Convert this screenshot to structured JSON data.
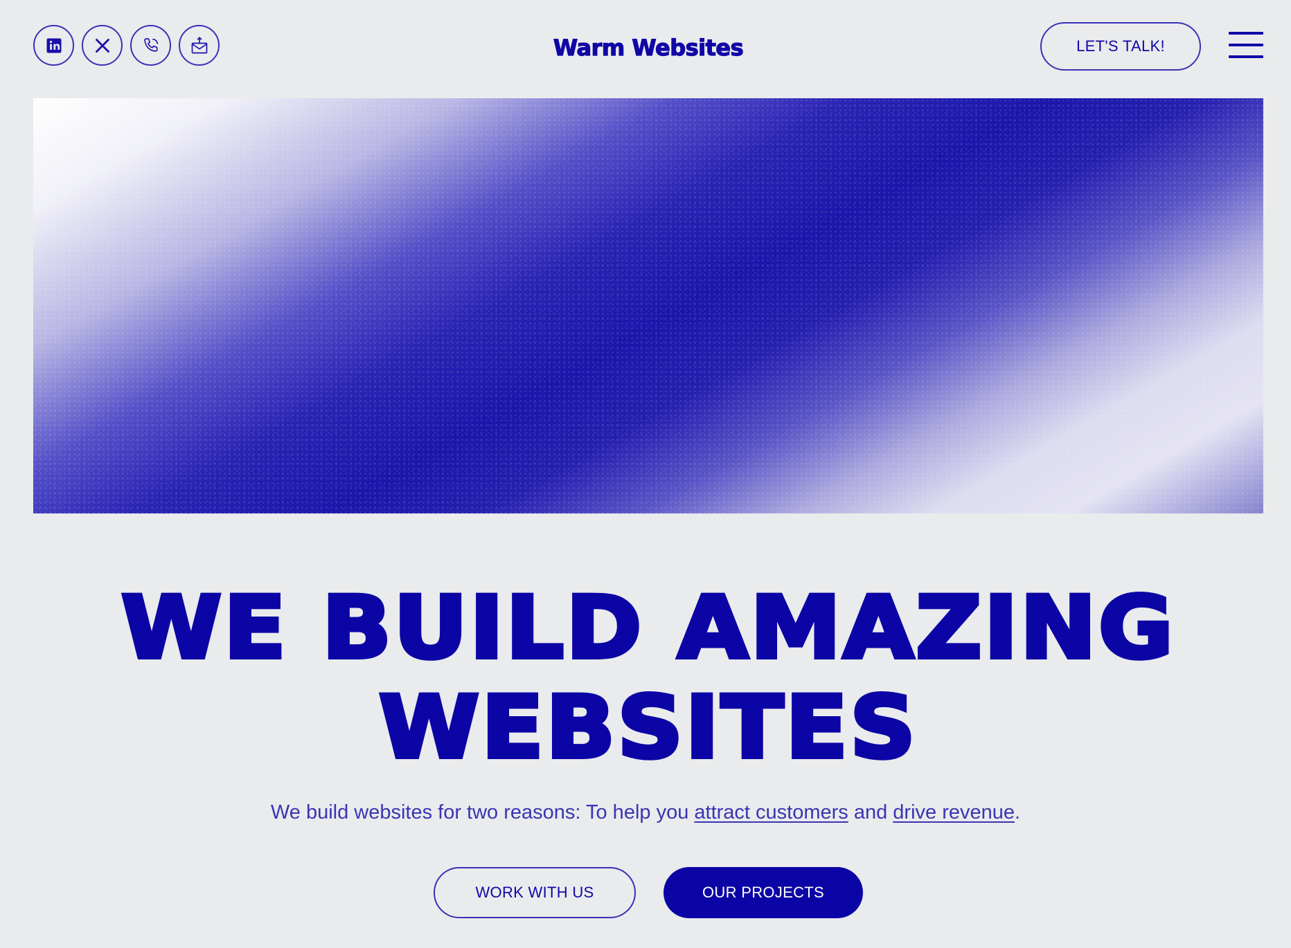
{
  "header": {
    "brand": "Warm Websites",
    "social": [
      {
        "icon": "linkedin-icon"
      },
      {
        "icon": "x-twitter-icon"
      },
      {
        "icon": "phone-icon"
      },
      {
        "icon": "mail-icon"
      }
    ],
    "cta_label": "LET'S TALK!",
    "menu_icon": "hamburger-menu-icon"
  },
  "hero": {
    "headline_line1": "WE BUILD AMAZING",
    "headline_line2": "WEBSITES",
    "subtext_prefix": "We build websites for two reasons: To help you ",
    "link1": "attract customers",
    "subtext_mid": " and ",
    "link2": "drive revenue",
    "subtext_suffix": ".",
    "primary_button": "WORK WITH US",
    "secondary_button": "OUR PROJECTS"
  },
  "colors": {
    "accent": "#0c05a5",
    "background": "#eaebed",
    "text": "#3a34b3"
  }
}
